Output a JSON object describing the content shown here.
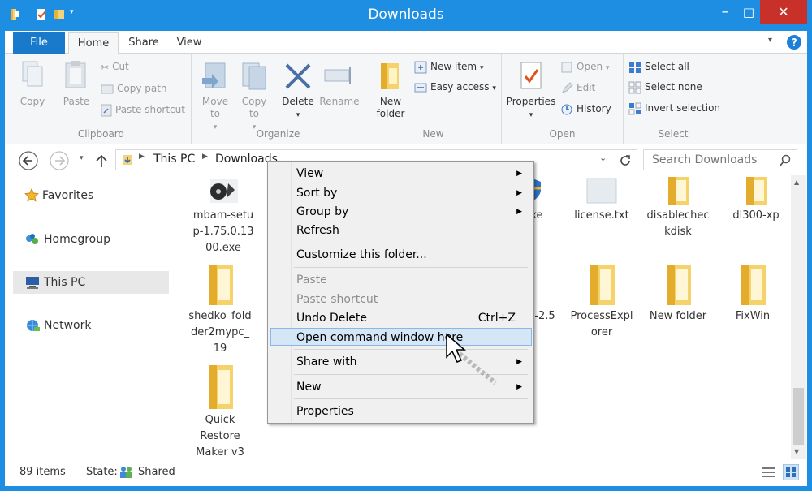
{
  "window": {
    "title": "Downloads"
  },
  "window_controls": {
    "minimize": "–",
    "maximize": "□",
    "close": "✕"
  },
  "tabs": {
    "file": "File",
    "home": "Home",
    "share": "Share",
    "view": "View"
  },
  "ribbon": {
    "clipboard": {
      "label": "Clipboard",
      "copy": "Copy",
      "paste": "Paste",
      "cut": "Cut",
      "copy_path": "Copy path",
      "paste_shortcut": "Paste shortcut"
    },
    "organize": {
      "label": "Organize",
      "move_to": "Move to",
      "copy_to": "Copy to",
      "delete": "Delete",
      "rename": "Rename"
    },
    "new": {
      "label": "New",
      "new_folder": "New folder",
      "new_item": "New item",
      "easy_access": "Easy access"
    },
    "open": {
      "label": "Open",
      "properties": "Properties",
      "open": "Open",
      "edit": "Edit",
      "history": "History"
    },
    "select": {
      "label": "Select",
      "select_all": "Select all",
      "select_none": "Select none",
      "invert_selection": "Invert selection"
    }
  },
  "address": {
    "this_pc": "This PC",
    "folder": "Downloads",
    "search_placeholder": "Search Downloads"
  },
  "nav": {
    "favorites": "Favorites",
    "homegroup": "Homegroup",
    "this_pc": "This PC",
    "network": "Network"
  },
  "files": [
    {
      "name": "mbam-setup-1.75.0.1300.exe",
      "line1": "mbam-setu",
      "line2": "p-1.75.0.13",
      "line3": "00.exe",
      "kind": "exe"
    },
    {
      "name": "exe",
      "line1": "exe",
      "kind": "exe"
    },
    {
      "name": "license.txt",
      "line1": "license.txt",
      "kind": "txt"
    },
    {
      "name": "disablecheckdisk",
      "line1": "disablechec",
      "line2": "kdisk",
      "kind": "folder"
    },
    {
      "name": "dl300-xp",
      "line1": "dl300-xp",
      "kind": "folder"
    },
    {
      "name": "shedko_folder2mypc_19",
      "line1": "shedko_fold",
      "line2": "der2mypc_",
      "line3": "19",
      "kind": "folder"
    },
    {
      "name": "-2.5",
      "line1": "-2.5",
      "kind": "folder"
    },
    {
      "name": "ProcessExplorer",
      "line1": "ProcessExpl",
      "line2": "orer",
      "kind": "folder"
    },
    {
      "name": "New folder",
      "line1": "New folder",
      "kind": "folder"
    },
    {
      "name": "FixWin",
      "line1": "FixWin",
      "kind": "folder"
    },
    {
      "name": "Quick Restore Maker v3",
      "line1": "Quick",
      "line2": "Restore",
      "line3": "Maker v3",
      "kind": "folder"
    }
  ],
  "status": {
    "items": "89 items",
    "state_label": "State:",
    "state_value": "Shared"
  },
  "context_menu": {
    "view": "View",
    "sort_by": "Sort by",
    "group_by": "Group by",
    "refresh": "Refresh",
    "customize": "Customize this folder...",
    "paste": "Paste",
    "paste_shortcut": "Paste shortcut",
    "undo_delete": "Undo Delete",
    "undo_shortcut": "Ctrl+Z",
    "open_cmd": "Open command window here",
    "share_with": "Share with",
    "new": "New",
    "properties": "Properties",
    "submenu_arrow": "▶"
  }
}
